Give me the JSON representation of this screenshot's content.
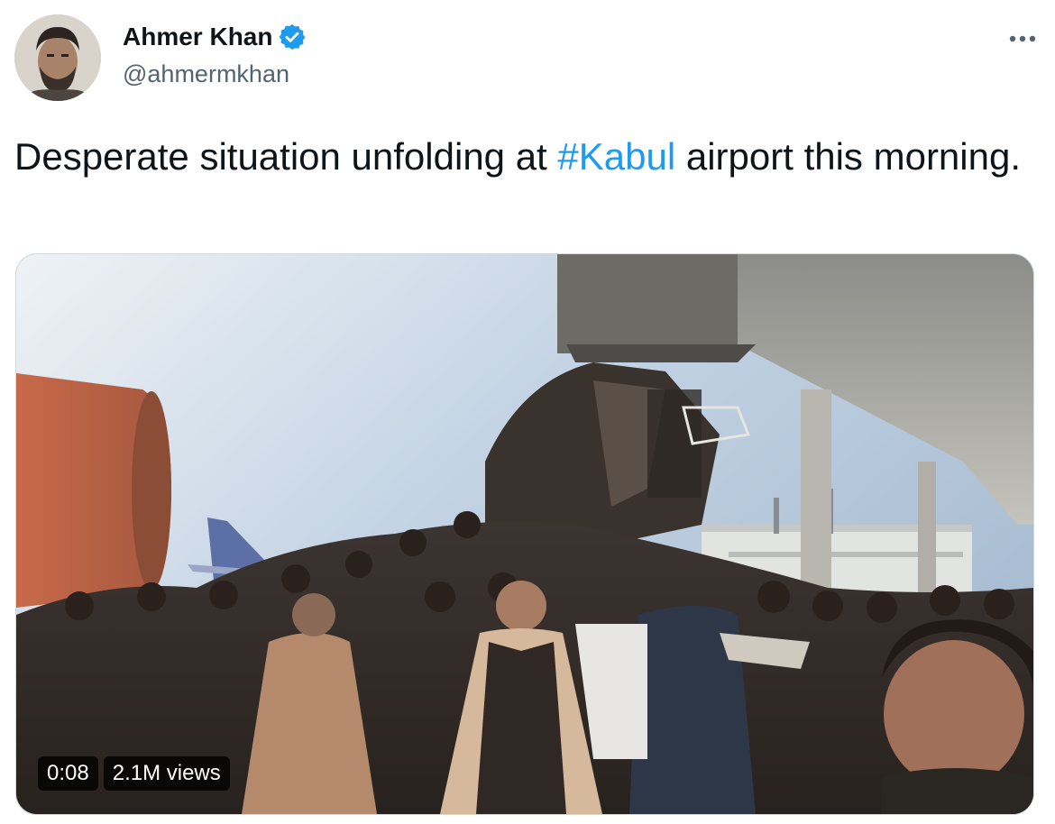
{
  "author": {
    "name": "Ahmer Khan",
    "handle": "@ahmermkhan",
    "verified": true,
    "avatar_icon": "profile-photo"
  },
  "menu": {
    "icon": "more-horizontal-icon",
    "label": "•••"
  },
  "tweet": {
    "text_before": "Desperate situation unfolding at ",
    "hashtag": "#Kabul",
    "text_after": " airport this morning.",
    "link_color": "#1d9bf0"
  },
  "media": {
    "type": "video",
    "duration": "0:08",
    "views": "2.1M views"
  }
}
